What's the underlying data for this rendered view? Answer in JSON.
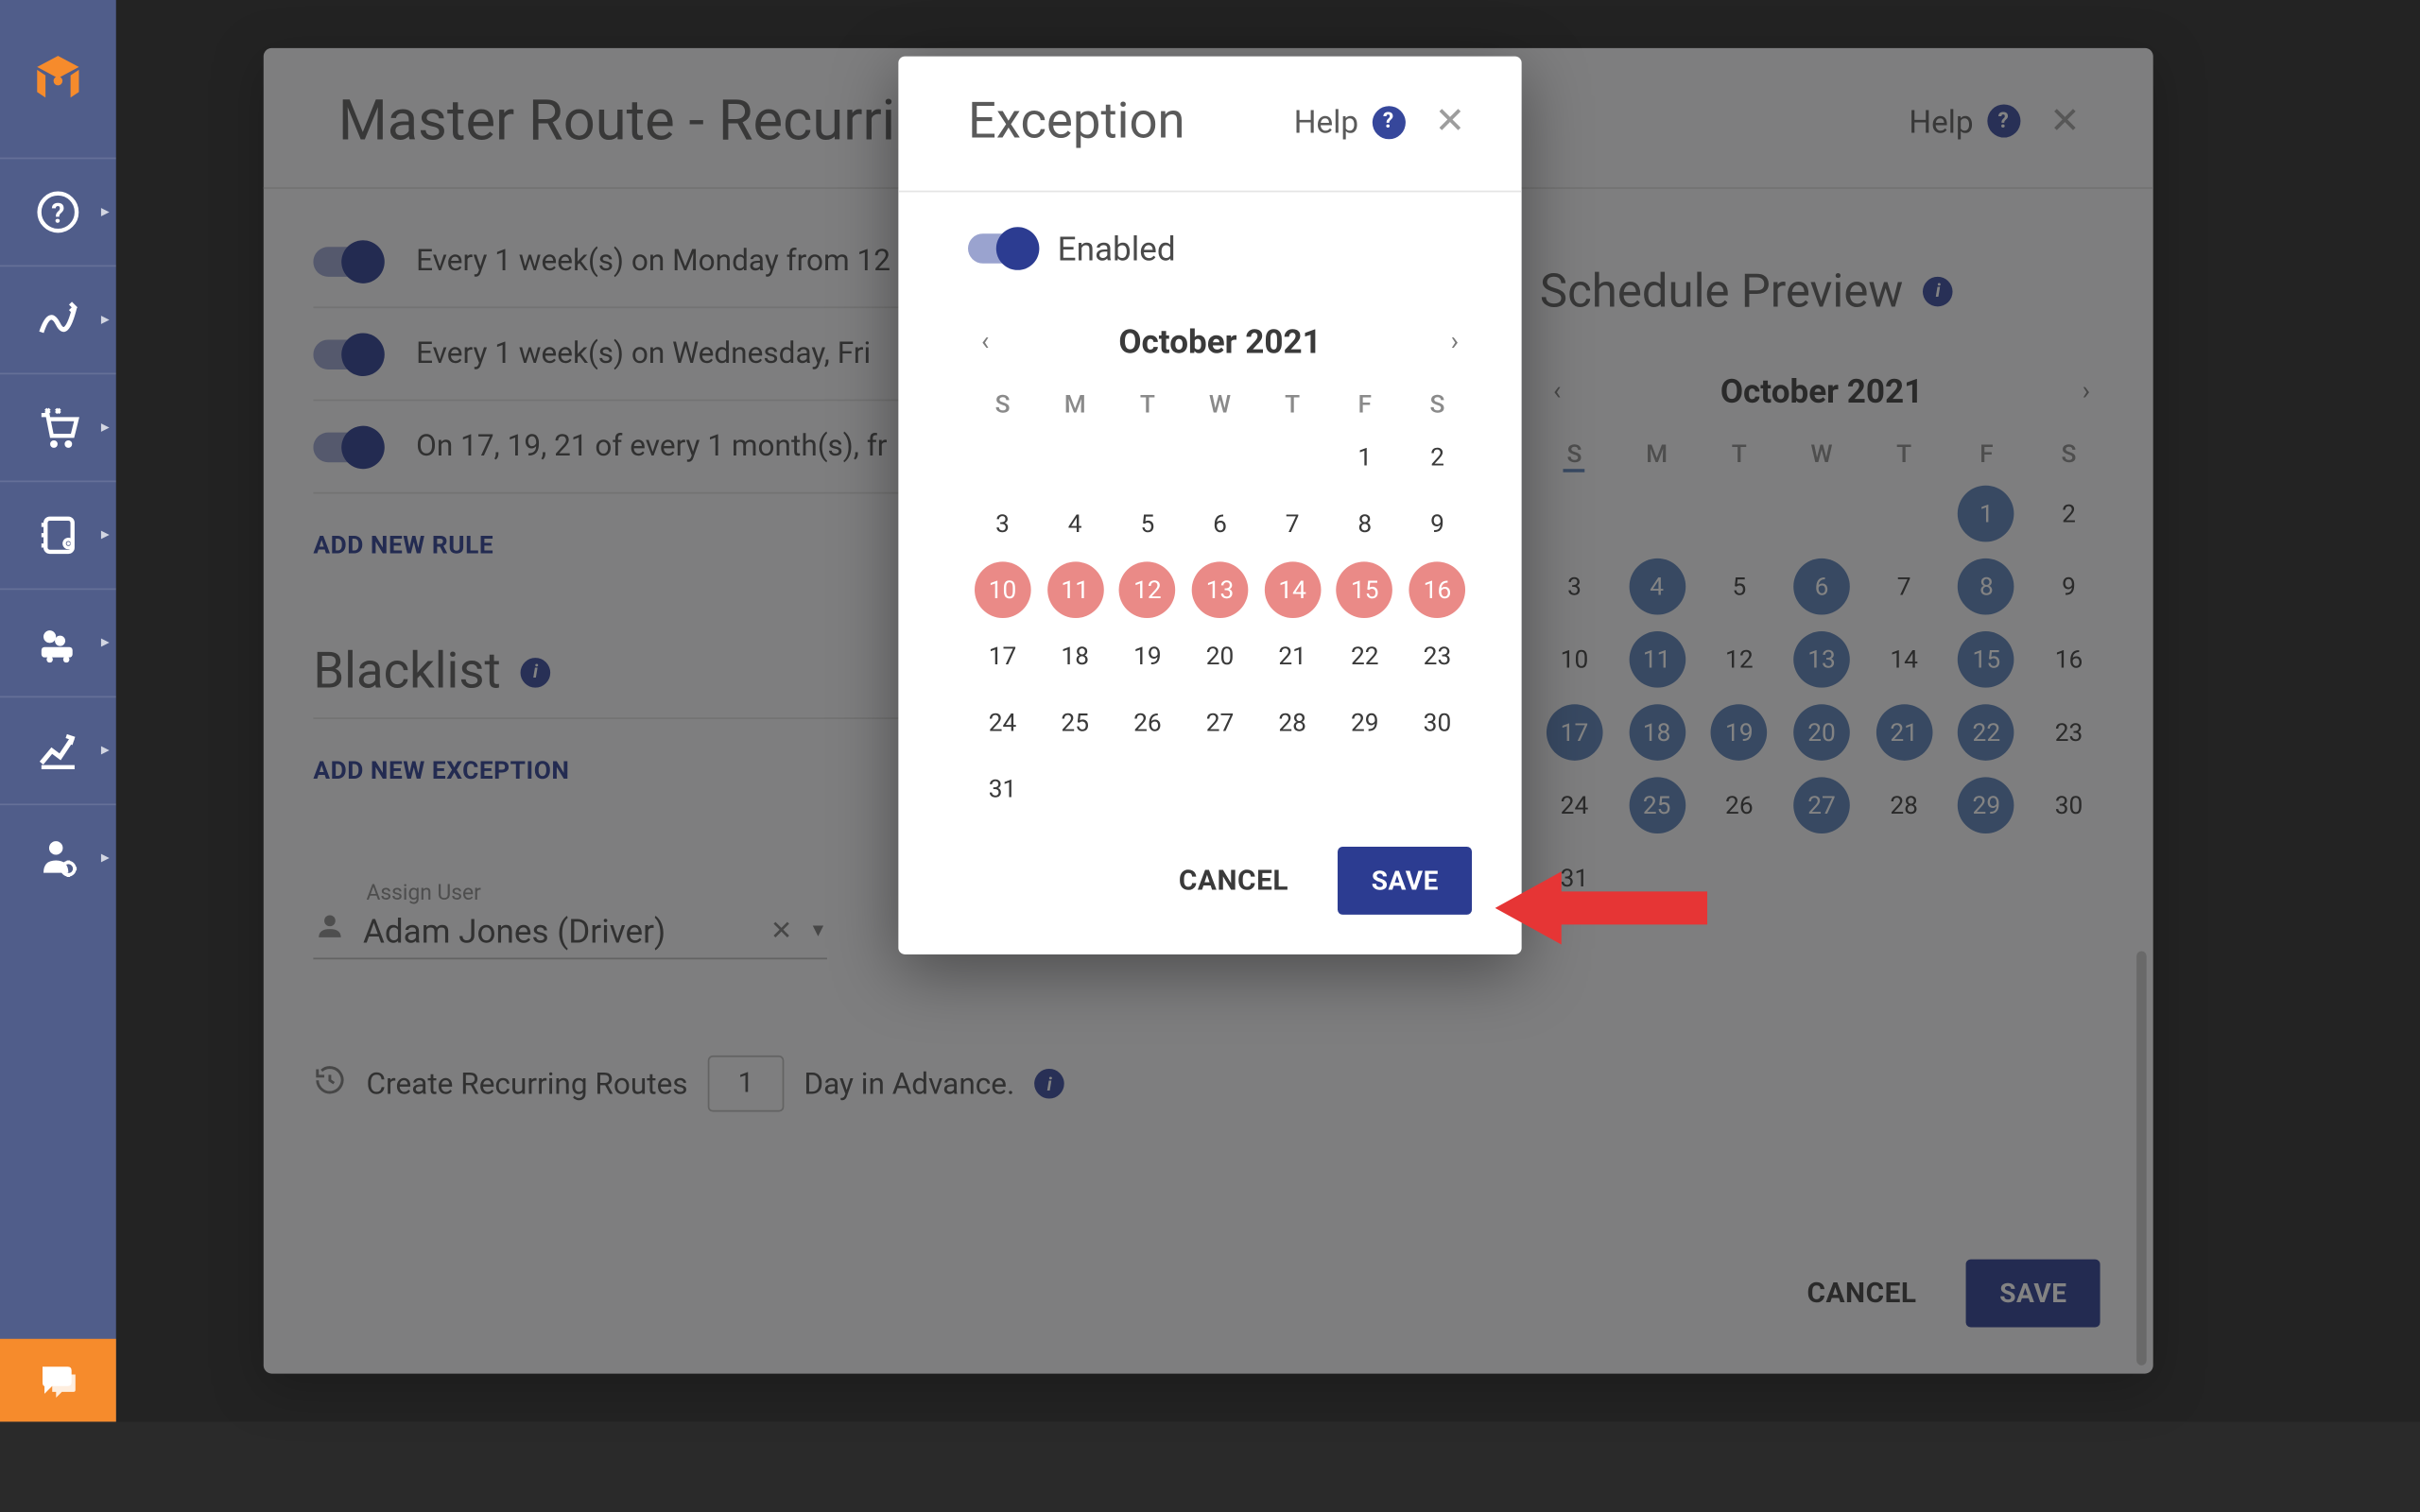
{
  "sidebar": {
    "nav": [
      "help",
      "routes",
      "cart",
      "book",
      "fleet",
      "analytics",
      "user-settings"
    ]
  },
  "mainModal": {
    "title": "Master Route - Recurrin",
    "help": "Help",
    "rules": [
      "Every 1 week(s) on Monday from 12",
      "Every 1 week(s) on Wednesday, Fri",
      "On 17, 19, 21 of every 1 month(s), fr"
    ],
    "addRule": "ADD NEW RULE",
    "blacklistTitle": "Blacklist",
    "addException": "ADD NEW EXCEPTION",
    "assignLabel": "Assign User",
    "assignValue": "Adam Jones (Driver)",
    "advancePrefix": "Create Recurring Routes",
    "advanceDays": "1",
    "advanceSuffix": "Day in Advance.",
    "footer": {
      "cancel": "CANCEL",
      "save": "SAVE"
    }
  },
  "preview": {
    "title": "Schedule Preview",
    "month": "October 2021",
    "dow": [
      "S",
      "M",
      "T",
      "W",
      "T",
      "F",
      "S"
    ],
    "highlighted": [
      1,
      4,
      6,
      8,
      11,
      13,
      15,
      17,
      18,
      19,
      20,
      21,
      22,
      25,
      27,
      29
    ],
    "firstDow": 5,
    "daysInMonth": 31
  },
  "exception": {
    "title": "Exception",
    "help": "Help",
    "enabledLabel": "Enabled",
    "month": "October 2021",
    "dow": [
      "S",
      "M",
      "T",
      "W",
      "T",
      "F",
      "S"
    ],
    "selected": [
      10,
      11,
      12,
      13,
      14,
      15,
      16
    ],
    "firstDow": 5,
    "daysInMonth": 31,
    "cancel": "CANCEL",
    "save": "SAVE"
  }
}
